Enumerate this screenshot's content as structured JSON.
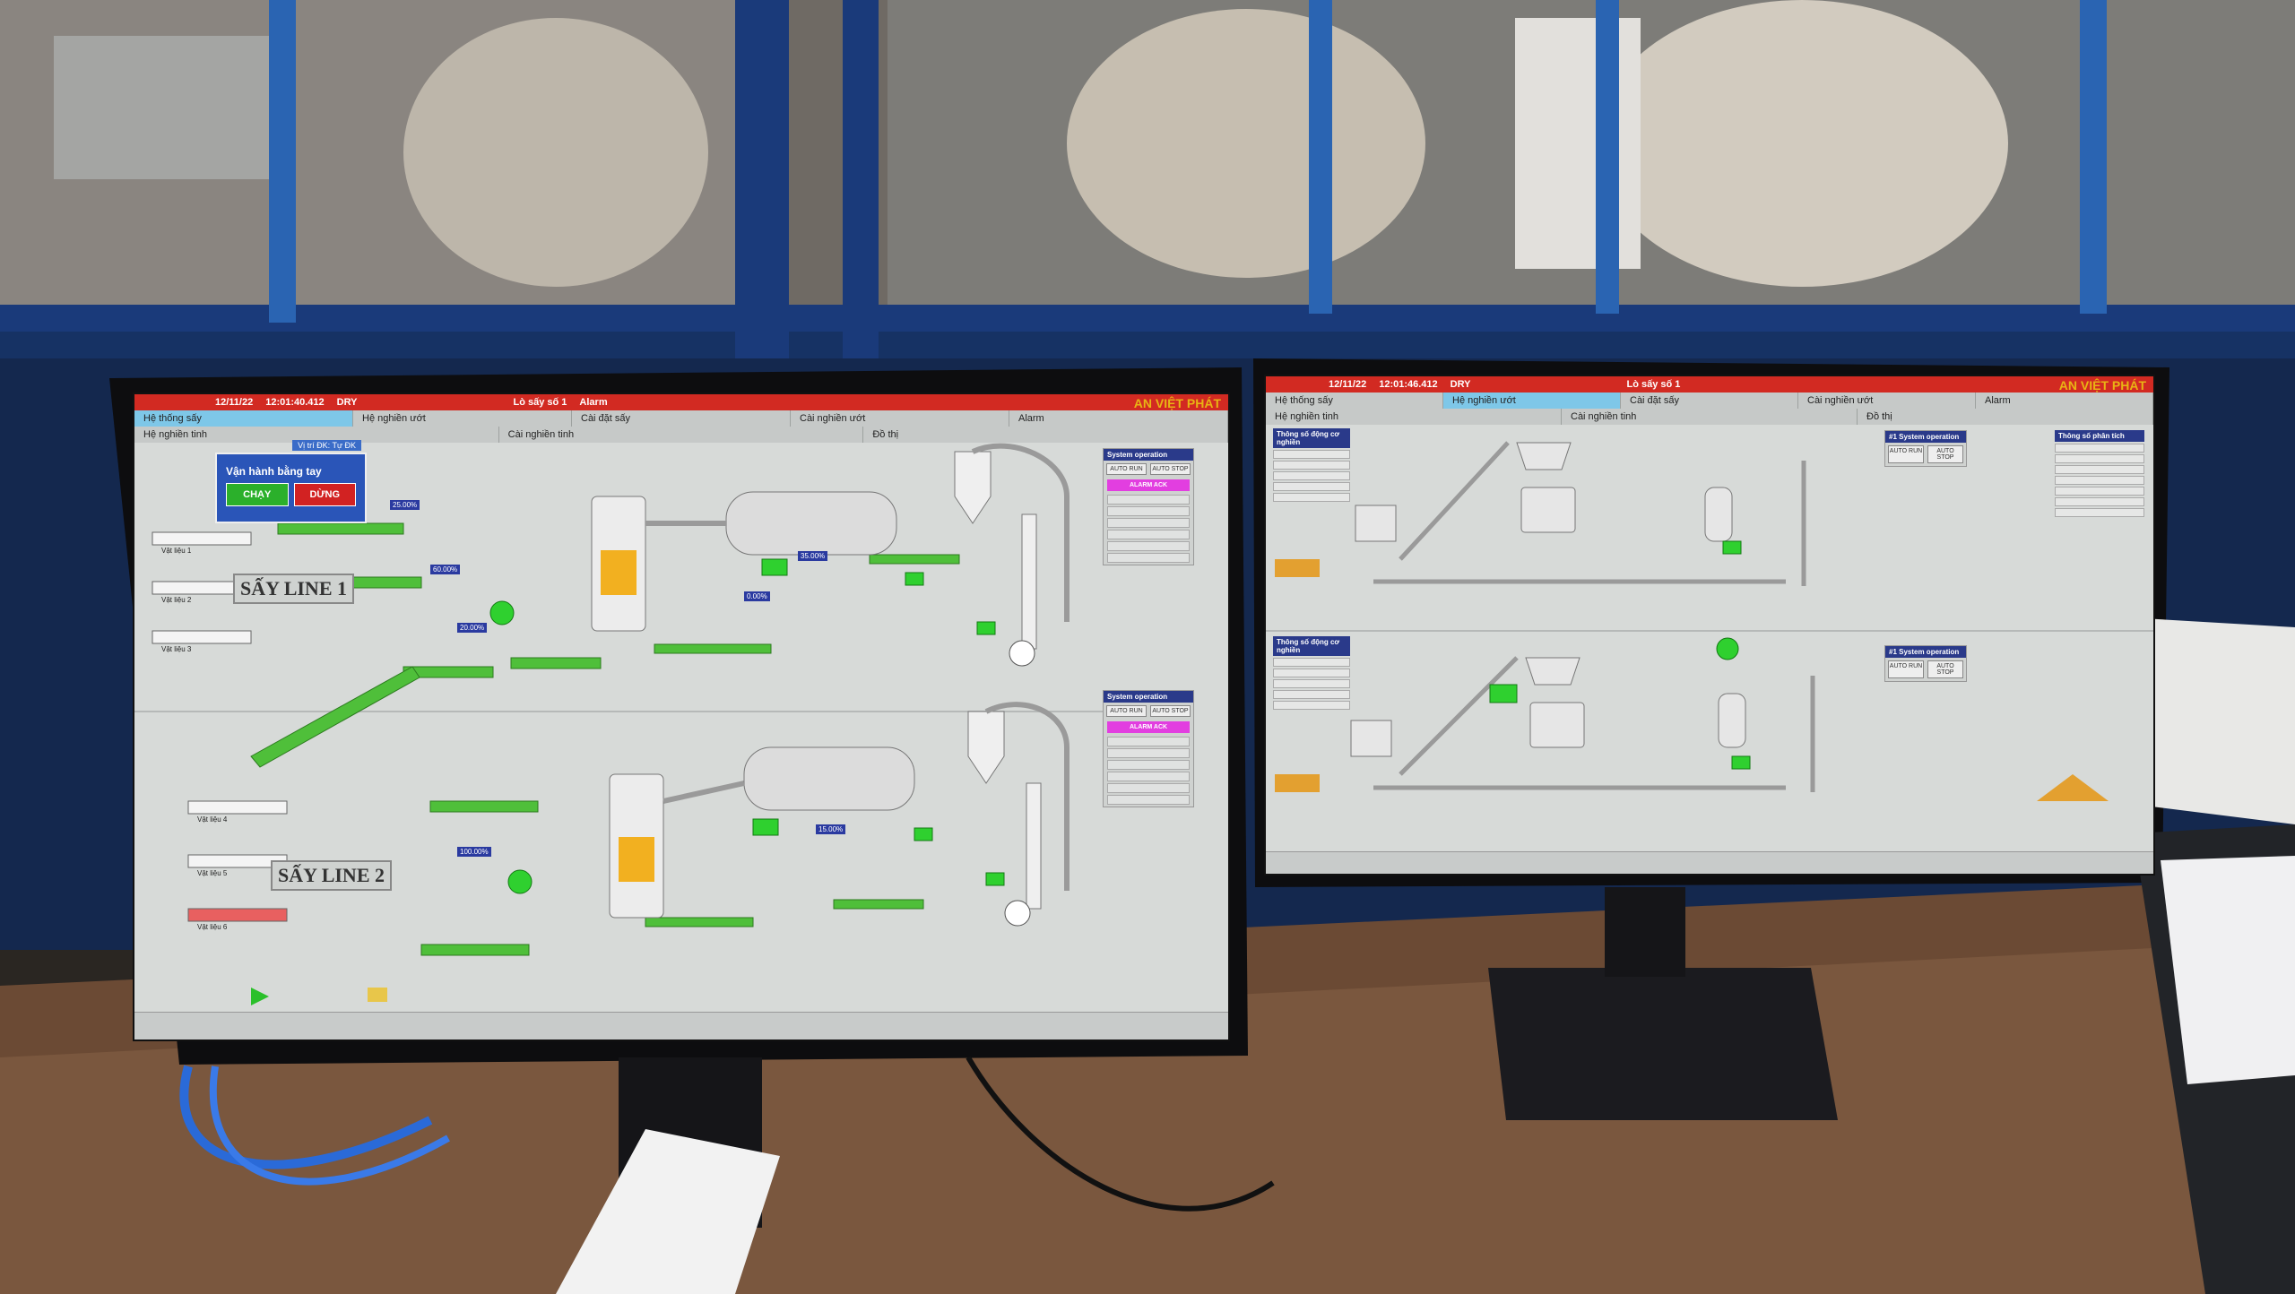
{
  "header": {
    "date": "12/11/22",
    "time_left": "12:01:40.412",
    "time_right": "12:01:46.412",
    "mode": "DRY",
    "title_left": "Lò sấy số 1",
    "title_right": "Lò sấy số 1",
    "alarm": "Alarm",
    "brand": "AN VIỆT PHÁT"
  },
  "left_tabs": {
    "row1": [
      "Hệ thống sấy",
      "Hệ nghiền ướt",
      "Cài đặt sấy",
      "Cài nghiền ướt",
      "Alarm"
    ],
    "row2": [
      "Hệ nghiền tinh",
      "Cài nghiền tinh",
      "Đồ thị"
    ]
  },
  "right_tabs": {
    "row1": [
      "Hệ thống sấy",
      "Hệ nghiền ướt",
      "Cài đặt sấy",
      "Cài nghiền ướt",
      "Alarm"
    ],
    "row2": [
      "Hệ nghiền tinh",
      "Cài nghiền tinh",
      "Đồ thị"
    ]
  },
  "lines": {
    "line1": "SẤY LINE 1",
    "line2": "SẤY LINE 2"
  },
  "modal": {
    "title": "Vận hành bằng tay",
    "start": "CHẠY",
    "stop": "DỪNG",
    "badge": "Vị trí ĐK: Tự ĐK"
  },
  "panel": {
    "title": "System operation",
    "auto_run": "AUTO RUN",
    "auto_stop": "AUTO STOP",
    "alarm_ack": "ALARM ACK"
  },
  "right_info": {
    "title1": "Thông số động cơ nghiền",
    "title2": "Thông số động cơ nghiền",
    "title3": "Thông số phân tích",
    "sys": "#1 System operation"
  },
  "bins": [
    "Vật liệu 1",
    "Vật liệu 2",
    "Vật liệu 3",
    "Vật liệu 4",
    "Vật liệu 5",
    "Vật liệu 6"
  ],
  "readouts": [
    "25.00%",
    "60.00%",
    "20.00%",
    "35.00%",
    "0.00%",
    "15.00%",
    "100.00%"
  ]
}
